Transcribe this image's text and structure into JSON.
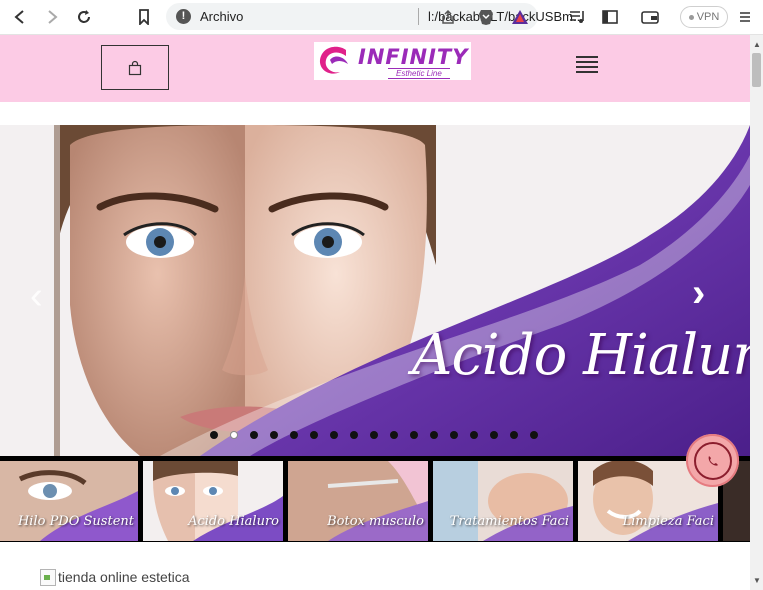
{
  "browser": {
    "address_label": "Archivo",
    "url": "l:/backabrilLT/backUSBm...",
    "vpn_label": "VPN"
  },
  "header": {
    "logo_text": "INFINITY",
    "logo_tagline": "Esthetic Line"
  },
  "carousel": {
    "slide_title": "Acido Hialuronico",
    "prev_arrow": "‹",
    "next_arrow": "›",
    "indicator_count": 17,
    "active_index": 1
  },
  "thumbnails": [
    {
      "caption": "Hilo PDO Sustent"
    },
    {
      "caption": "Acido Hialuro"
    },
    {
      "caption": "Botox musculo"
    },
    {
      "caption": "Tratamientos Faci"
    },
    {
      "caption": "Limpieza Faci"
    }
  ],
  "content": {
    "banner_alt": "tienda online estetica"
  },
  "colors": {
    "header_bg": "#fccbe5",
    "brand_purple": "#9b2bb8",
    "whatsapp_bg": "#f3a7a9"
  },
  "icons": [
    "back-icon",
    "forward-icon",
    "reload-icon",
    "bookmark-icon",
    "info-icon",
    "share-icon",
    "brave-icon",
    "rewards-icon",
    "playlist-icon",
    "sidebar-icon",
    "wallet-icon",
    "menu-icon",
    "cart-icon",
    "hamburger-icon",
    "whatsapp-icon"
  ]
}
